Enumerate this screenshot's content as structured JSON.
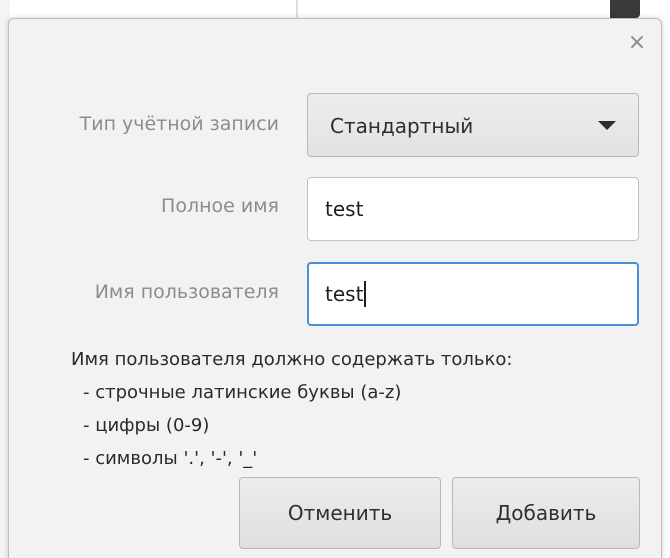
{
  "dialog": {
    "close_glyph": "×",
    "account_type": {
      "label": "Тип учётной записи",
      "selected": "Стандартный"
    },
    "full_name": {
      "label": "Полное имя",
      "value": "test"
    },
    "username": {
      "label": "Имя пользователя",
      "value": "test"
    },
    "hint": {
      "title": "Имя пользователя должно содержать только:",
      "items": [
        "- строчные латинские буквы (a-z)",
        "- цифры (0-9)",
        "- символы '.', '-', '_'"
      ]
    },
    "cancel_label": "Отменить",
    "add_label": "Добавить"
  },
  "icons": {
    "close": "close-icon",
    "dropdown": "chevron-down-icon"
  },
  "colors": {
    "focus_border": "#4a90d9",
    "dialog_bg": "#f2f2f2",
    "label_text": "#8c8c8c"
  }
}
